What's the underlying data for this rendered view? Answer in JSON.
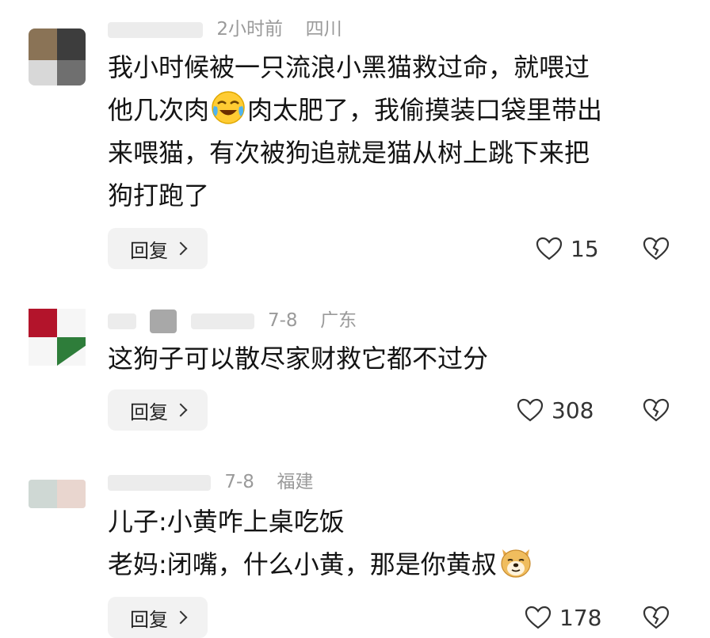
{
  "comments": [
    {
      "time": "2小时前",
      "location": "四川",
      "lines": [
        "我小时候被一只流浪小黑猫救过命，就喂过",
        [
          "他几次肉",
          "肉太肥了，我偷摸装口袋里带出"
        ],
        "来喂猫，有次被狗追就是猫从树上跳下来把",
        "狗打跑了"
      ],
      "reply_label": "回复",
      "likes": "15",
      "emoji": "crying-laughing"
    },
    {
      "time": "7-8",
      "location": "广东",
      "lines": [
        "这狗子可以散尽家财救它都不过分"
      ],
      "reply_label": "回复",
      "likes": "308"
    },
    {
      "time": "7-8",
      "location": "福建",
      "lines": [
        "儿子:小黄咋上桌吃饭",
        [
          "老妈:闭嘴，什么小黄，那是你黄叔",
          ""
        ]
      ],
      "reply_label": "回复",
      "likes": "178",
      "emoji": "doge"
    }
  ],
  "colors": {
    "meta_text": "#9a9a9a",
    "body_text": "#141414",
    "reply_bg": "#f2f2f2"
  },
  "icons": {
    "like": "heart-outline-icon",
    "dislike": "broken-heart-icon",
    "reply_chevron": "chevron-right-icon"
  }
}
